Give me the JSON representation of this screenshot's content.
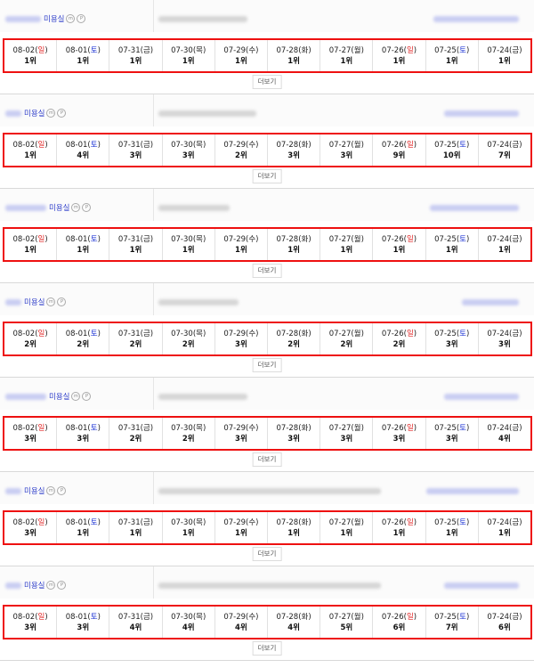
{
  "dates": [
    {
      "date": "08-02",
      "dow": "일",
      "kind": "sun"
    },
    {
      "date": "08-01",
      "dow": "토",
      "kind": "sat"
    },
    {
      "date": "07-31",
      "dow": "금",
      "kind": "wk"
    },
    {
      "date": "07-30",
      "dow": "목",
      "kind": "wk"
    },
    {
      "date": "07-29",
      "dow": "수",
      "kind": "wk"
    },
    {
      "date": "07-28",
      "dow": "화",
      "kind": "wk"
    },
    {
      "date": "07-27",
      "dow": "월",
      "kind": "wk"
    },
    {
      "date": "07-26",
      "dow": "일",
      "kind": "sun"
    },
    {
      "date": "07-25",
      "dow": "토",
      "kind": "sat"
    },
    {
      "date": "07-24",
      "dow": "금",
      "kind": "wk"
    }
  ],
  "more_label": "더보기",
  "shops": [
    {
      "name": "미용실",
      "ranks": [
        "1위",
        "1위",
        "1위",
        "1위",
        "1위",
        "1위",
        "1위",
        "1위",
        "1위",
        "1위"
      ]
    },
    {
      "name": "미용실",
      "ranks": [
        "1위",
        "4위",
        "3위",
        "3위",
        "2위",
        "3위",
        "3위",
        "9위",
        "10위",
        "7위"
      ]
    },
    {
      "name": "미용실",
      "ranks": [
        "1위",
        "1위",
        "1위",
        "1위",
        "1위",
        "1위",
        "1위",
        "1위",
        "1위",
        "1위"
      ]
    },
    {
      "name": "미용실",
      "ranks": [
        "2위",
        "2위",
        "2위",
        "2위",
        "3위",
        "2위",
        "2위",
        "2위",
        "3위",
        "3위"
      ]
    },
    {
      "name": "미용실",
      "ranks": [
        "3위",
        "3위",
        "2위",
        "2위",
        "3위",
        "3위",
        "3위",
        "3위",
        "3위",
        "4위"
      ]
    },
    {
      "name": "미용실",
      "ranks": [
        "3위",
        "1위",
        "1위",
        "1위",
        "1위",
        "1위",
        "1위",
        "1위",
        "1위",
        "1위"
      ]
    },
    {
      "name": "미용실",
      "ranks": [
        "3위",
        "3위",
        "4위",
        "4위",
        "4위",
        "4위",
        "5위",
        "6위",
        "7위",
        "6위"
      ]
    }
  ]
}
